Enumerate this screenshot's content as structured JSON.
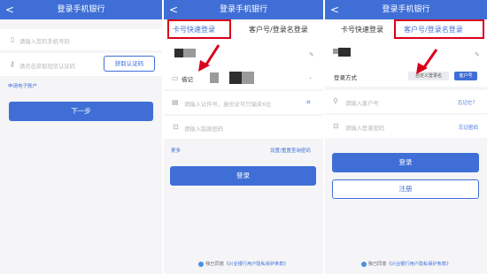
{
  "panel1": {
    "back_glyph": "<",
    "title": "登录手机银行",
    "phone_placeholder": "请输入您的手机号码",
    "sms_placeholder": "请点击获取短信认证码",
    "get_code_button": "获取认证码",
    "apply_account_link": "申请电子账户",
    "next_button": "下一步"
  },
  "panel2": {
    "back_glyph": "<",
    "title": "登录手机银行",
    "tabs": [
      {
        "label": "卡号快速登录"
      },
      {
        "label": "客户号/登录名登录"
      }
    ],
    "card_type_label": "借记",
    "id_placeholder": "请输入证件号，身份证可只输末6位",
    "pin_placeholder": "请输入取款密码",
    "more_link": "更多",
    "reset_link": "设置/重置查询密码",
    "login_button": "登录",
    "footer_prefix": "我已同意",
    "footer_link": "《兴业银行用户隐私保护条款》"
  },
  "panel3": {
    "back_glyph": "<",
    "title": "登录手机银行",
    "tabs": [
      {
        "label": "卡号快速登录"
      },
      {
        "label": "客户号/登录名登录"
      }
    ],
    "login_method_label": "登录方式",
    "custom_name_tag": "自定义登录名",
    "customer_no_tag": "客户号",
    "customer_no_placeholder": "请输入客户号",
    "forgot_customer_no": "忘记它？",
    "password_placeholder": "请输入登录密码",
    "forgot_password": "忘记密码",
    "login_button": "登录",
    "register_button": "注册",
    "footer_prefix": "我已同意",
    "footer_link": "《兴业银行用户隐私保护条款》"
  },
  "colors": {
    "brand_blue": "#3f6fd6",
    "highlight_red": "#d9001b"
  },
  "icons": [
    "back-icon",
    "phone-icon",
    "key-icon",
    "card-icon",
    "lock-icon",
    "user-icon",
    "edit-icon",
    "scan-icon",
    "checkbox-icon",
    "arrow-annotation"
  ]
}
